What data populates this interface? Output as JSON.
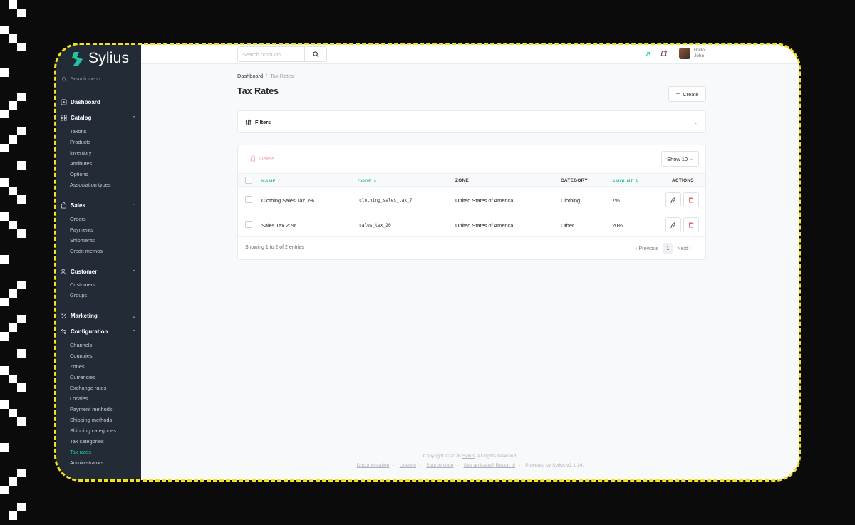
{
  "app": {
    "name": "Sylius"
  },
  "sidebar": {
    "search_placeholder": "Search menu...",
    "dashboard": "Dashboard",
    "sections": [
      {
        "label": "Catalog",
        "items": [
          "Taxons",
          "Products",
          "Inventory",
          "Attributes",
          "Options",
          "Association types"
        ]
      },
      {
        "label": "Sales",
        "items": [
          "Orders",
          "Payments",
          "Shipments",
          "Credit memos"
        ]
      },
      {
        "label": "Customer",
        "items": [
          "Customers",
          "Groups"
        ]
      },
      {
        "label": "Marketing",
        "items": []
      },
      {
        "label": "Configuration",
        "items": [
          "Channels",
          "Countries",
          "Zones",
          "Currencies",
          "Exchange rates",
          "Locales",
          "Payment methods",
          "Shipping methods",
          "Shipping categories",
          "Tax categories",
          "Tax rates",
          "Administrators"
        ]
      }
    ],
    "active_item": "Tax rates"
  },
  "topbar": {
    "search_placeholder": "Search products...",
    "user_greeting": "Hello",
    "user_name": "John"
  },
  "page": {
    "breadcrumb_root": "Dashboard",
    "breadcrumb_current": "Tax Rates",
    "title": "Tax Rates",
    "create_label": "Create",
    "filters_label": "Filters",
    "delete_label": "Delete",
    "show_label": "Show 10"
  },
  "table": {
    "headers": {
      "name": "NAME",
      "code": "CODE",
      "zone": "ZONE",
      "category": "CATEGORY",
      "amount": "AMOUNT",
      "actions": "ACTIONS"
    },
    "rows": [
      {
        "name": "Clothing Sales Tax 7%",
        "code": "clothing_sales_tax_7",
        "zone": "United States of America",
        "category": "Clothing",
        "amount": "7%"
      },
      {
        "name": "Sales Tax 20%",
        "code": "sales_tax_20",
        "zone": "United States of America",
        "category": "Other",
        "amount": "20%"
      }
    ],
    "showing": "Showing 1 to 2 of 2 entries",
    "pager": {
      "previous": "Previous",
      "page": "1",
      "next": "Next"
    }
  },
  "footer": {
    "copyright_prefix": "Copyright © 2026",
    "copyright_link": "Sylius",
    "copyright_suffix": ". All rights reserved.",
    "links": [
      "Documentation",
      "License",
      "Source code",
      "See an issue? Report it!"
    ],
    "powered": "Powered by Sylius v2.1.14."
  },
  "colors": {
    "accent": "#22c3a0",
    "sidebar_bg": "#232b36",
    "border_dashed": "#f2e21b",
    "danger": "#e05555"
  }
}
